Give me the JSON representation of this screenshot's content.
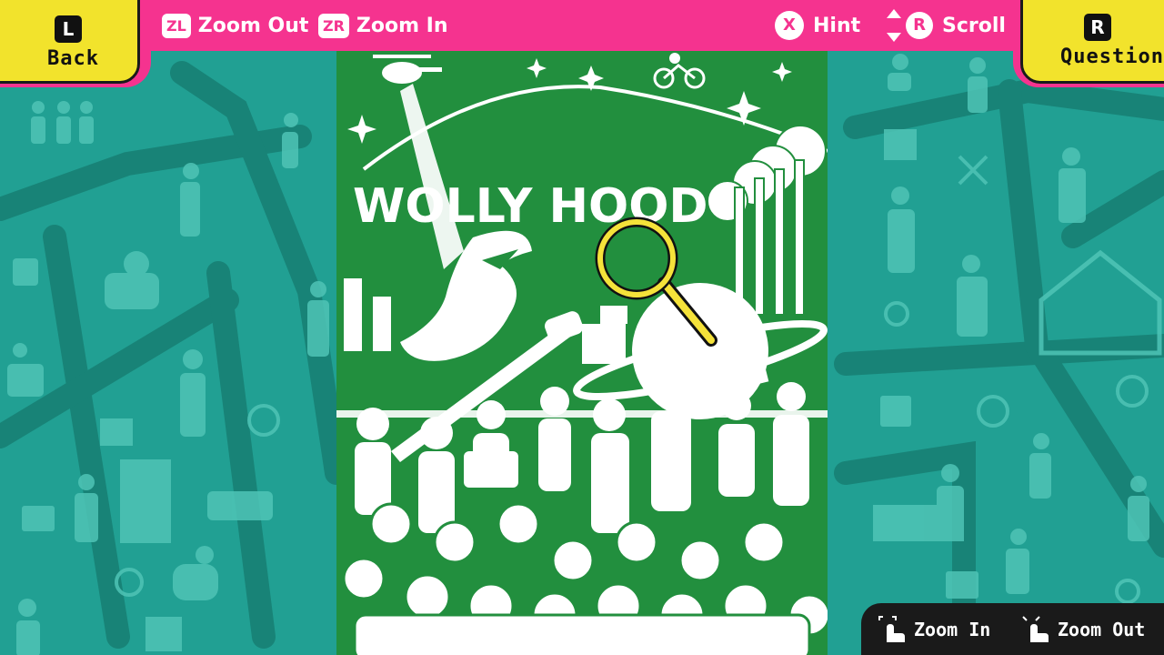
{
  "top_bar": {
    "back": {
      "button_glyph": "L",
      "label": "Back"
    },
    "question": {
      "button_glyph": "R",
      "label": "Question"
    },
    "zoom_out": {
      "button_glyph": "ZL",
      "label": "Zoom Out"
    },
    "zoom_in": {
      "button_glyph": "ZR",
      "label": "Zoom In"
    },
    "hint": {
      "button_glyph": "X",
      "label": "Hint"
    },
    "scroll": {
      "button_glyph": "R",
      "label": "Scroll",
      "icon": "updown-arrows-icon"
    }
  },
  "scene": {
    "sign_text": "WOLLY HOOD",
    "background_color": "#228f3e"
  },
  "bottom_controls": {
    "zoom_in": {
      "label": "Zoom In",
      "icon": "pinch-out-icon"
    },
    "zoom_out": {
      "label": "Zoom Out",
      "icon": "pinch-in-icon"
    }
  },
  "colors": {
    "pink": "#f5338f",
    "yellow": "#f2e32c",
    "teal_bg": "#1f9e92",
    "scene_green": "#228f3e",
    "magnifier": "#f5e23a"
  }
}
